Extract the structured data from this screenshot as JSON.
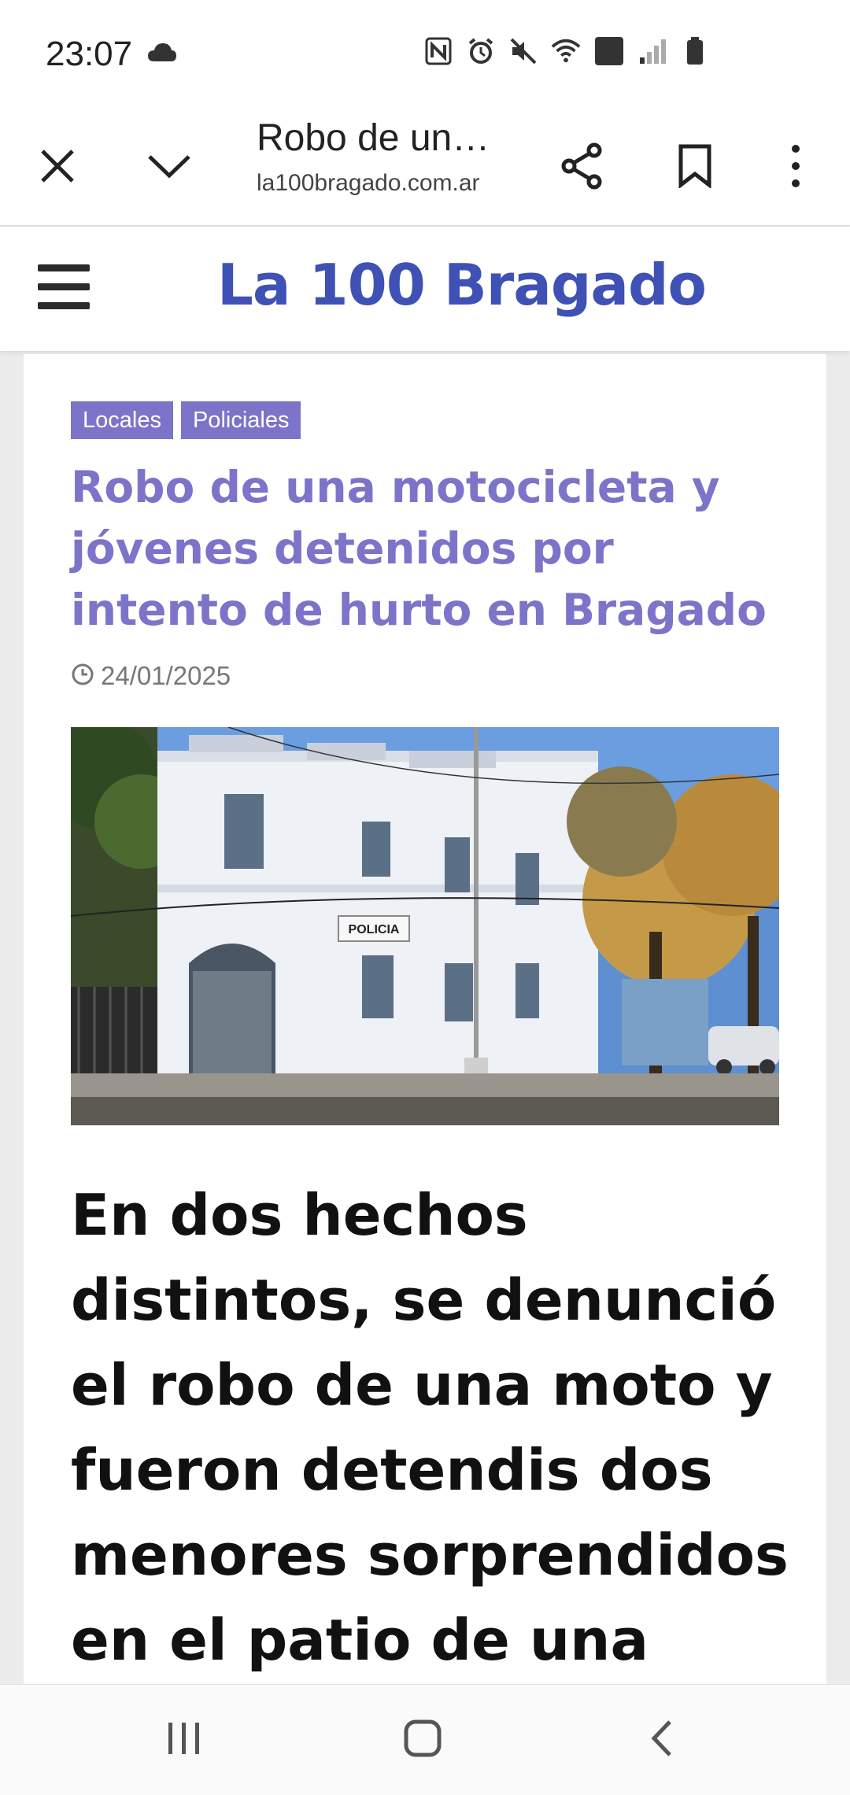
{
  "status_bar": {
    "time": "23:07",
    "icons": [
      "cloud-icon",
      "nfc-icon",
      "alarm-icon",
      "mute-icon",
      "wifi-icon",
      "volte-4g-icon",
      "signal-icon",
      "battery-icon"
    ],
    "volte_label": "Voz 4G"
  },
  "browser_bar": {
    "title": "Robo de una motocicleta y jóvenes detenidos...",
    "url": "la100bragado.com.ar"
  },
  "site_header": {
    "logo_text": "La 100 Bragado",
    "logo_color": "#3f51b5"
  },
  "article": {
    "tags": [
      "Locales",
      "Policiales"
    ],
    "tag_color": "#7c74c9",
    "headline": "Robo de una motocicleta y jóvenes detenidos por intento de hurto en Bragado",
    "date": "24/01/2025",
    "image_sign": "POLICIA",
    "lead": "En dos hechos distintos, se denunció el robo de una moto y fueron detendis dos menores sorprendidos en el patio de una vivienda."
  },
  "nav_bar": {
    "buttons": [
      "recent-apps",
      "home",
      "back"
    ]
  }
}
